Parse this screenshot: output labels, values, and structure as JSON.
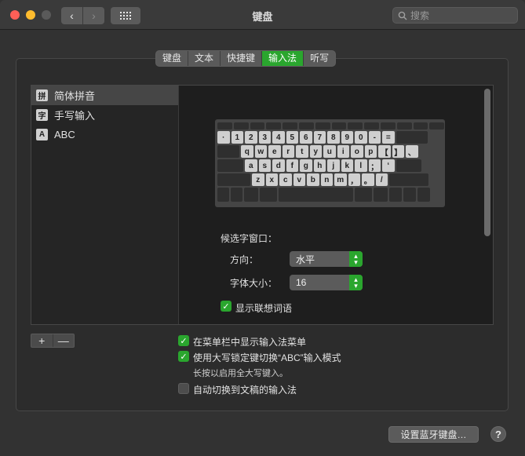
{
  "window": {
    "title": "键盘"
  },
  "toolbar": {
    "back": "‹",
    "forward": "›",
    "search_placeholder": "搜索"
  },
  "tabs": [
    {
      "label": "键盘",
      "active": false
    },
    {
      "label": "文本",
      "active": false
    },
    {
      "label": "快捷键",
      "active": false
    },
    {
      "label": "输入法",
      "active": true
    },
    {
      "label": "听写",
      "active": false
    }
  ],
  "sources": [
    {
      "icon": "拼",
      "label": "简体拼音",
      "selected": true
    },
    {
      "icon": "字",
      "label": "手写输入",
      "selected": false
    },
    {
      "icon": "A",
      "label": "ABC",
      "selected": false
    }
  ],
  "keyboard": {
    "row1": [
      "·",
      "1",
      "2",
      "3",
      "4",
      "5",
      "6",
      "7",
      "8",
      "9",
      "0",
      "-",
      "="
    ],
    "row2": [
      "q",
      "w",
      "e",
      "r",
      "t",
      "y",
      "u",
      "i",
      "o",
      "p",
      "【",
      "】",
      "、"
    ],
    "row3": [
      "a",
      "s",
      "d",
      "f",
      "g",
      "h",
      "j",
      "k",
      "l",
      "；",
      "‘"
    ],
    "row4": [
      "z",
      "x",
      "c",
      "v",
      "b",
      "n",
      "m",
      "，",
      "。",
      "/"
    ]
  },
  "candidate": {
    "section_label": "候选字窗口：",
    "direction_label": "方向：",
    "direction_value": "水平",
    "font_size_label": "字体大小：",
    "font_size_value": "16",
    "show_predictive_label": "显示联想词语",
    "show_predictive_checked": true
  },
  "list_controls": {
    "add": "+",
    "remove": "—"
  },
  "options": {
    "show_in_menubar_label": "在菜单栏中显示输入法菜单",
    "show_in_menubar_checked": true,
    "capslock_label": "使用大写锁定键切换“ABC”输入模式",
    "capslock_checked": true,
    "capslock_hint": "长按以启用全大写键入。",
    "auto_switch_label": "自动切换到文稿的输入法",
    "auto_switch_checked": false
  },
  "footer": {
    "bluetooth_button": "设置蓝牙键盘…",
    "help": "?"
  },
  "colors": {
    "accent": "#2aa62e",
    "background": "#323232"
  }
}
